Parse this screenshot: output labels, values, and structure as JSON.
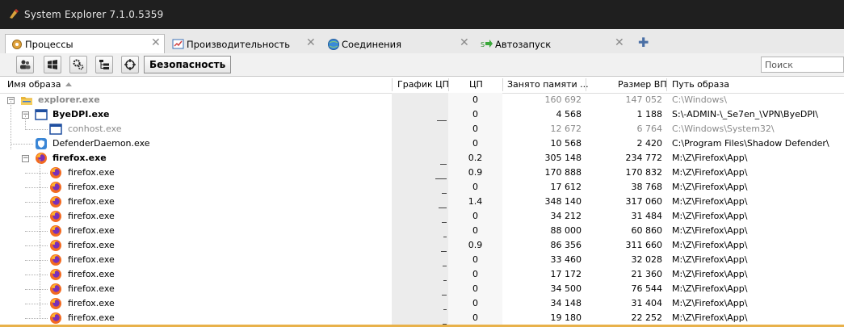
{
  "window": {
    "title": "System Explorer 7.1.0.5359"
  },
  "tabs": [
    {
      "label": "Процессы",
      "icon": "gear-icon",
      "active": true
    },
    {
      "label": "Производительность",
      "icon": "monitor-chart-icon",
      "active": false
    },
    {
      "label": "Соединения",
      "icon": "globe-icon",
      "active": false
    },
    {
      "label": "Автозапуск",
      "icon": "autorun-arrow-icon",
      "active": false
    }
  ],
  "toolbar": {
    "security_label": "Безопасность",
    "search_placeholder": "Поиск",
    "icons": [
      "users-icon",
      "windows-icon",
      "gears-icon",
      "tree-view-icon",
      "crosshair-icon"
    ]
  },
  "columns": {
    "name": "Имя образа",
    "graph": "График ЦП",
    "cpu": "ЦП",
    "mem": "Занято памяти ...",
    "vm": "Размер ВП",
    "path": "Путь образа"
  },
  "processes": [
    {
      "name": "explorer.exe",
      "cpu": "0",
      "mem": "160 692",
      "vm": "147 052",
      "path": "C:\\Windows\\",
      "level": 0,
      "expanded": true,
      "style": "gray-bold",
      "icon": "folder-icon"
    },
    {
      "name": "ByeDPI.exe",
      "cpu": "0",
      "mem": "4 568",
      "vm": "1 188",
      "path": "S:\\-ADMIN-\\_Se7en_\\VPN\\ByeDPI\\",
      "level": 1,
      "expanded": true,
      "style": "bold",
      "icon": "window-icon"
    },
    {
      "name": "conhost.exe",
      "cpu": "0",
      "mem": "12 672",
      "vm": "6 764",
      "path": "C:\\Windows\\System32\\",
      "level": 2,
      "style": "gray",
      "icon": "window-icon"
    },
    {
      "name": "DefenderDaemon.exe",
      "cpu": "0",
      "mem": "10 568",
      "vm": "2 420",
      "path": "C:\\Program Files\\Shadow Defender\\",
      "level": 1,
      "style": "normal",
      "icon": "shield-icon"
    },
    {
      "name": "firefox.exe",
      "cpu": "0.2",
      "mem": "305 148",
      "vm": "234 772",
      "path": "M:\\Z\\Firefox\\App\\",
      "level": 1,
      "expanded": true,
      "style": "bold",
      "icon": "firefox-icon"
    },
    {
      "name": "firefox.exe",
      "cpu": "0.9",
      "mem": "170 888",
      "vm": "170 832",
      "path": "M:\\Z\\Firefox\\App\\",
      "level": 2,
      "style": "normal",
      "icon": "firefox-icon"
    },
    {
      "name": "firefox.exe",
      "cpu": "0",
      "mem": "17 612",
      "vm": "38 768",
      "path": "M:\\Z\\Firefox\\App\\",
      "level": 2,
      "style": "normal",
      "icon": "firefox-icon"
    },
    {
      "name": "firefox.exe",
      "cpu": "1.4",
      "mem": "348 140",
      "vm": "317 060",
      "path": "M:\\Z\\Firefox\\App\\",
      "level": 2,
      "style": "normal",
      "icon": "firefox-icon"
    },
    {
      "name": "firefox.exe",
      "cpu": "0",
      "mem": "34 212",
      "vm": "31 484",
      "path": "M:\\Z\\Firefox\\App\\",
      "level": 2,
      "style": "normal",
      "icon": "firefox-icon"
    },
    {
      "name": "firefox.exe",
      "cpu": "0",
      "mem": "88 000",
      "vm": "60 860",
      "path": "M:\\Z\\Firefox\\App\\",
      "level": 2,
      "style": "normal",
      "icon": "firefox-icon"
    },
    {
      "name": "firefox.exe",
      "cpu": "0.9",
      "mem": "86 356",
      "vm": "311 660",
      "path": "M:\\Z\\Firefox\\App\\",
      "level": 2,
      "style": "normal",
      "icon": "firefox-icon"
    },
    {
      "name": "firefox.exe",
      "cpu": "0",
      "mem": "33 460",
      "vm": "32 028",
      "path": "M:\\Z\\Firefox\\App\\",
      "level": 2,
      "style": "normal",
      "icon": "firefox-icon"
    },
    {
      "name": "firefox.exe",
      "cpu": "0",
      "mem": "17 172",
      "vm": "21 360",
      "path": "M:\\Z\\Firefox\\App\\",
      "level": 2,
      "style": "normal",
      "icon": "firefox-icon"
    },
    {
      "name": "firefox.exe",
      "cpu": "0",
      "mem": "34 500",
      "vm": "76 544",
      "path": "M:\\Z\\Firefox\\App\\",
      "level": 2,
      "style": "normal",
      "icon": "firefox-icon"
    },
    {
      "name": "firefox.exe",
      "cpu": "0",
      "mem": "34 148",
      "vm": "31 404",
      "path": "M:\\Z\\Firefox\\App\\",
      "level": 2,
      "style": "normal",
      "icon": "firefox-icon"
    },
    {
      "name": "firefox.exe",
      "cpu": "0",
      "mem": "19 180",
      "vm": "22 252",
      "path": "M:\\Z\\Firefox\\App\\",
      "level": 2,
      "style": "normal",
      "icon": "firefox-icon"
    }
  ]
}
